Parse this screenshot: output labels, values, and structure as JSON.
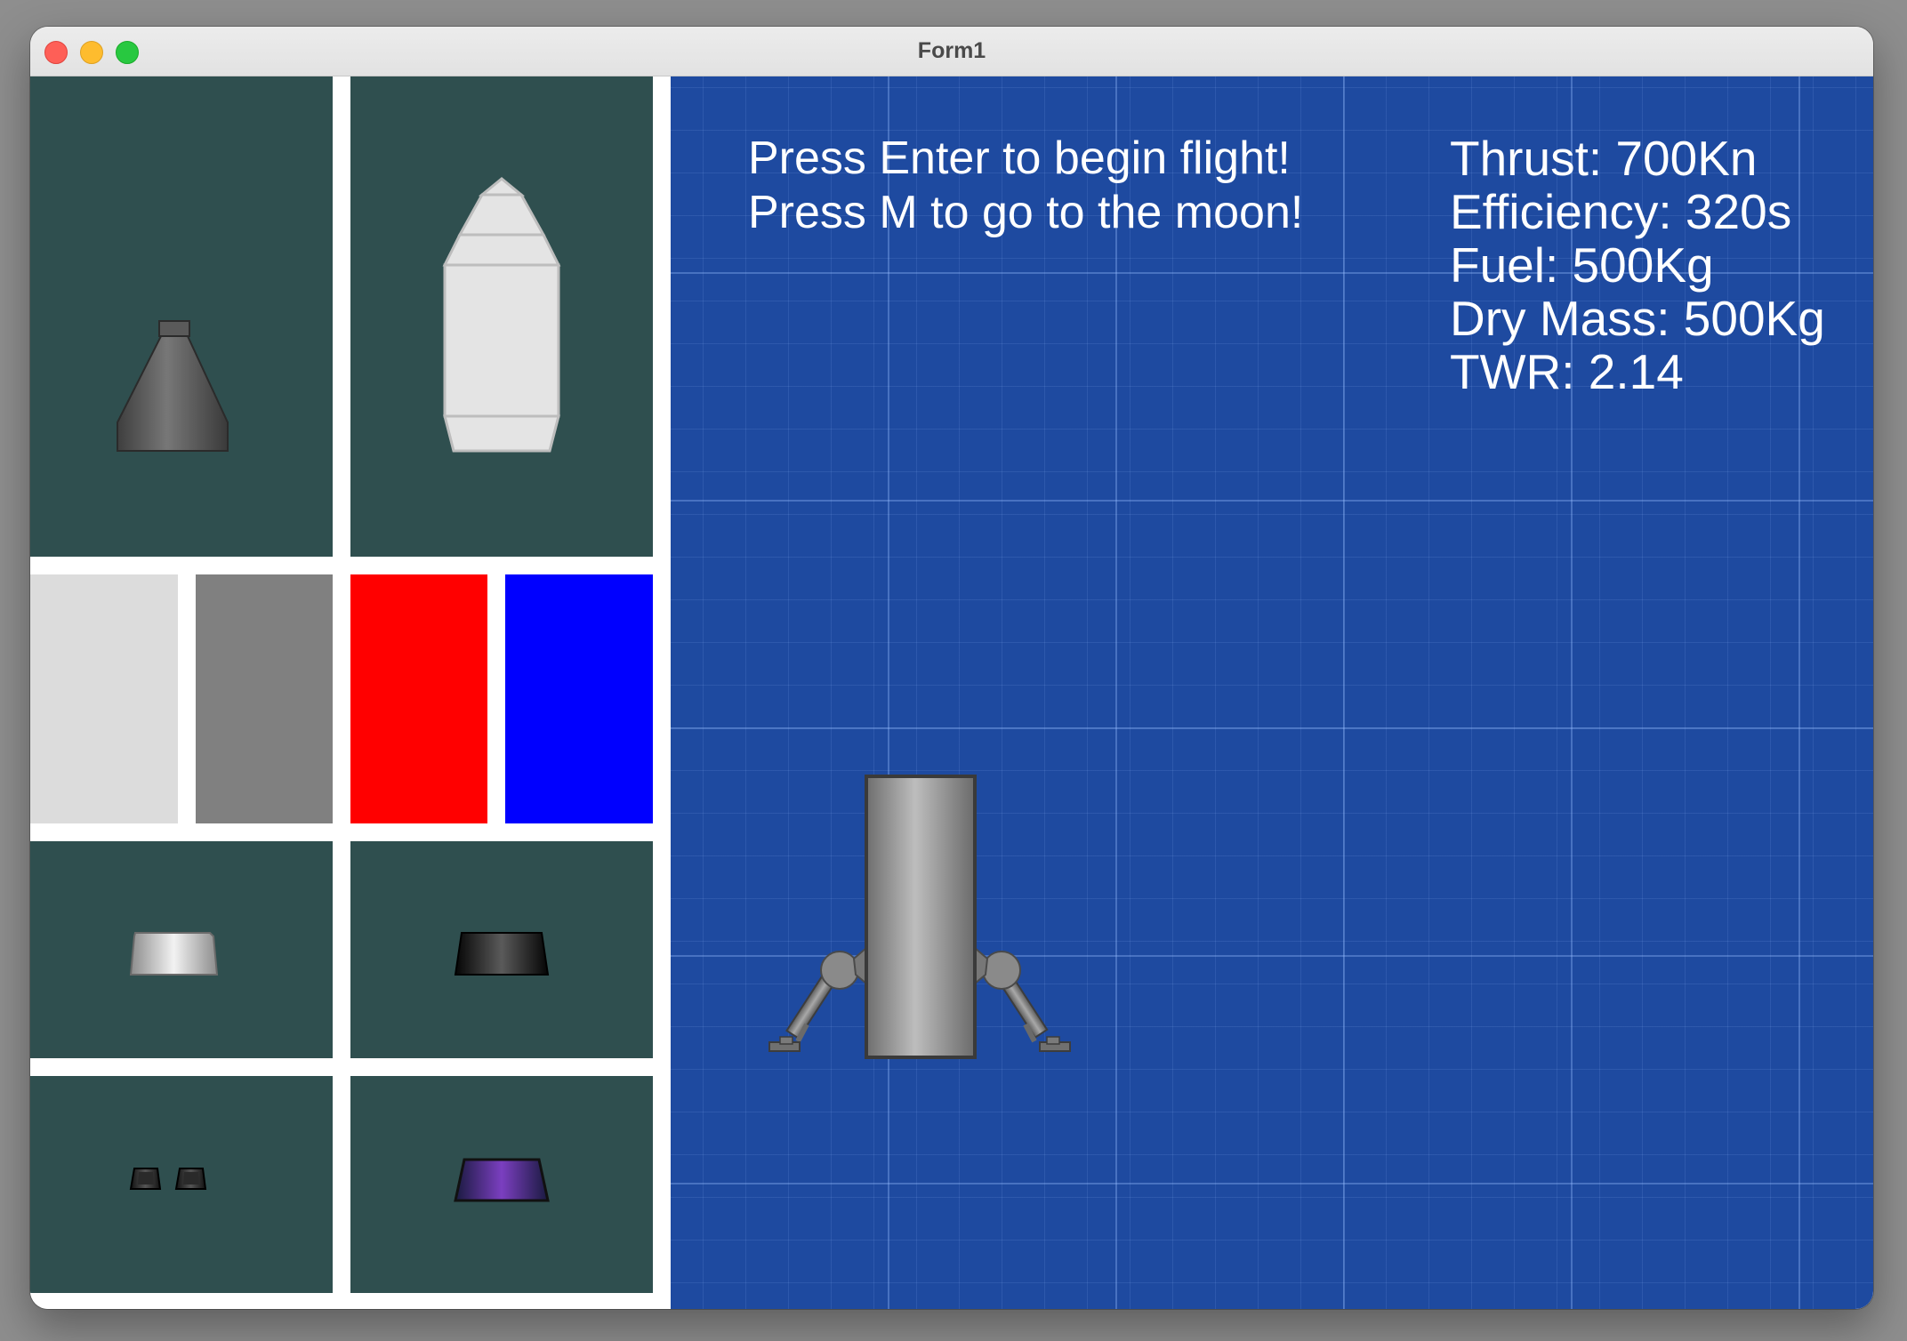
{
  "window": {
    "title": "Form1",
    "controls": {
      "close": "close-icon",
      "minimize": "minimize-icon",
      "zoom": "zoom-icon"
    }
  },
  "parts_palette": {
    "parts": [
      {
        "name": "engine-nozzle",
        "icon": "engine-nozzle-icon"
      },
      {
        "name": "capsule",
        "icon": "capsule-icon"
      },
      {
        "name": "silver-trapezoid-part",
        "icon": "silver-trapezoid-icon"
      },
      {
        "name": "black-trapezoid-part",
        "icon": "black-trapezoid-icon"
      },
      {
        "name": "twin-thruster-part",
        "icon": "twin-thruster-icon"
      },
      {
        "name": "purple-trapezoid-part",
        "icon": "purple-trapezoid-icon"
      }
    ],
    "colors": [
      "#dcdcdc",
      "#808080",
      "#ff0000",
      "#0000ff"
    ],
    "cell_background": "#2f4f4f"
  },
  "flight_view": {
    "instructions": [
      "Press Enter to begin flight!",
      "Press M to go to the moon!"
    ],
    "stats": {
      "thrust": "Thrust: 700Kn",
      "efficiency": "Efficiency: 320s",
      "fuel": "Fuel: 500Kg",
      "dry_mass": "Dry Mass: 500Kg",
      "twr": "TWR: 2.14"
    },
    "background_color": "#1e4aa0",
    "rocket_icon": "lander-icon"
  }
}
